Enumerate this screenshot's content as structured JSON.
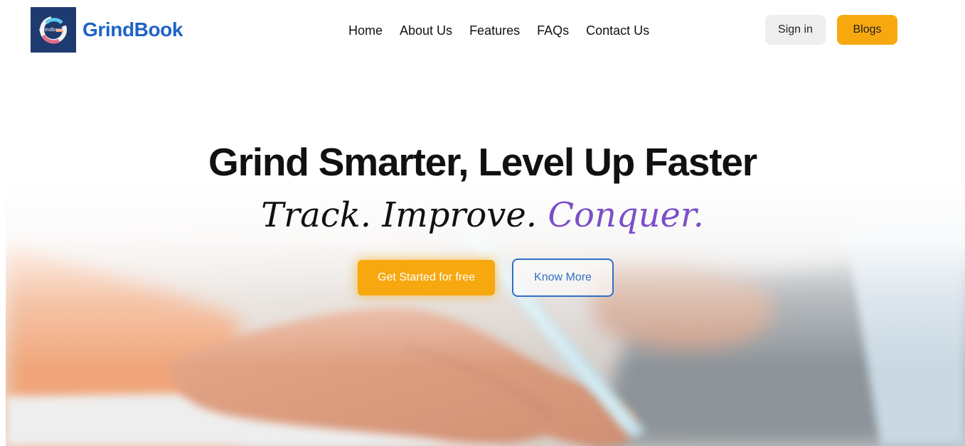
{
  "brand": {
    "name": "GrindBook",
    "logo_icon": "grindbook-logo-icon",
    "logo_text": "grindbook",
    "color_primary": "#1f63c6",
    "color_logo_bg": "#1f3a6e"
  },
  "nav": {
    "links": [
      "Home",
      "About Us",
      "Features",
      "FAQs",
      "Contact Us"
    ],
    "signin_label": "Sign in",
    "blogs_label": "Blogs"
  },
  "hero": {
    "title": "Grind Smarter, Level Up Faster",
    "tagline_part1": "Track. Improve.",
    "tagline_accent": "Conquer.",
    "accent_color": "#7b4fc8",
    "cta_primary": "Get Started for free",
    "cta_secondary": "Know More",
    "cta_color": "#f8a80f",
    "background_image": "hand-writing-with-pen-photo"
  }
}
